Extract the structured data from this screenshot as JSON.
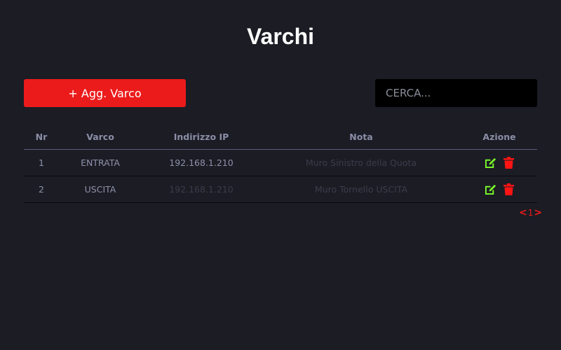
{
  "page": {
    "title": "Varchi"
  },
  "toolbar": {
    "add_label": "+ Agg. Varco",
    "search_placeholder": "CERCA..."
  },
  "table": {
    "columns": [
      "Nr",
      "Varco",
      "Indirizzo IP",
      "Nota",
      "Azione"
    ],
    "rows": [
      {
        "nr": "1",
        "varco": "ENTRATA",
        "ip": "192.168.1.210",
        "nota": "Muro Sinistro della Quota"
      },
      {
        "nr": "2",
        "varco": "USCITA",
        "ip": "192.168.1.210",
        "nota": "Muro Tornello USCITA"
      }
    ]
  },
  "icons": {
    "edit": "edit-icon",
    "delete": "trash-icon"
  },
  "colors": {
    "accent": "#ec1b1b",
    "edit": "#7dff2a",
    "background": "#1b1c24"
  },
  "pagination": {
    "prev": "<",
    "page": "1",
    "next": ">"
  }
}
